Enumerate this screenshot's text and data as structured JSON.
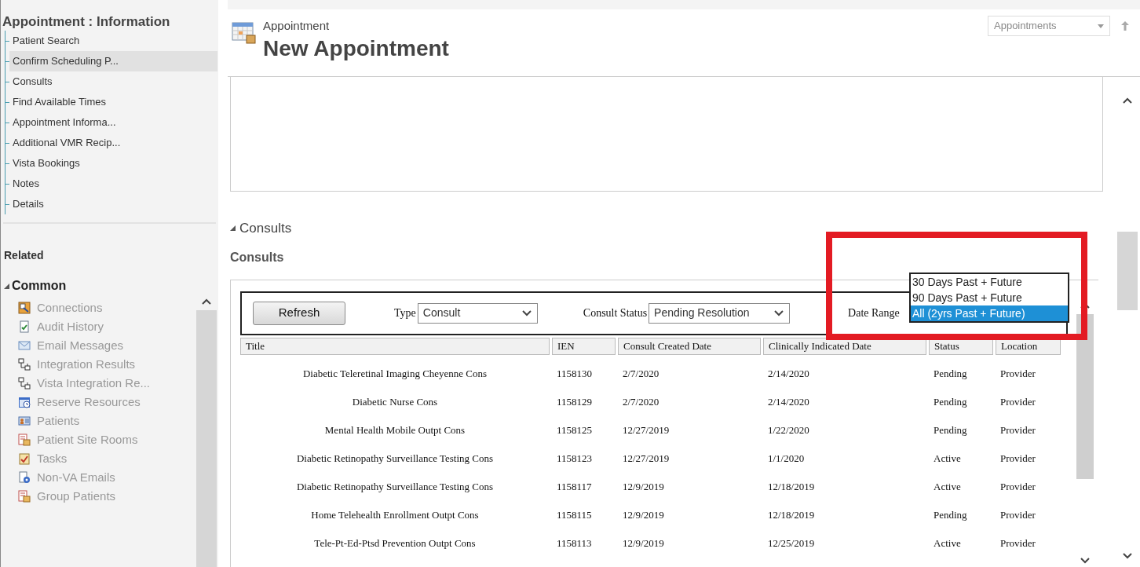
{
  "sidebar": {
    "title": "Appointment : Information",
    "nav_items": [
      {
        "label": "Patient Search",
        "selected": false
      },
      {
        "label": "Confirm Scheduling P...",
        "selected": true
      },
      {
        "label": "Consults",
        "selected": false
      },
      {
        "label": "Find Available Times",
        "selected": false
      },
      {
        "label": "Appointment Informa...",
        "selected": false
      },
      {
        "label": "Additional VMR Recip...",
        "selected": false
      },
      {
        "label": "Vista Bookings",
        "selected": false
      },
      {
        "label": "Notes",
        "selected": false
      },
      {
        "label": "Details",
        "selected": false
      }
    ],
    "related_heading": "Related",
    "group": {
      "label": "Common",
      "expanded": true,
      "items": [
        {
          "label": "Connections",
          "kind": "connections"
        },
        {
          "label": "Audit History",
          "kind": "document"
        },
        {
          "label": "Email Messages",
          "kind": "envelope"
        },
        {
          "label": "Integration Results",
          "kind": "network"
        },
        {
          "label": "Vista Integration Re...",
          "kind": "network"
        },
        {
          "label": "Reserve Resources",
          "kind": "calendar"
        },
        {
          "label": "Patients",
          "kind": "contact"
        },
        {
          "label": "Patient Site Rooms",
          "kind": "box"
        },
        {
          "label": "Tasks",
          "kind": "clipboard"
        },
        {
          "label": "Non-VA Emails",
          "kind": "gear"
        },
        {
          "label": "Group Patients",
          "kind": "box"
        }
      ]
    }
  },
  "header": {
    "entity": "Appointment",
    "title": "New Appointment",
    "form_selector": "Appointments"
  },
  "section_toggle": {
    "label": "Consults",
    "expanded": true
  },
  "consults": {
    "heading": "Consults",
    "refresh": "Refresh",
    "filters": [
      {
        "label": "Type",
        "value": "Consult"
      },
      {
        "label": "Consult Status",
        "value": "Pending Resolution"
      },
      {
        "label": "Date Range"
      }
    ],
    "date_range_options": [
      {
        "label": "30 Days Past + Future",
        "selected": false
      },
      {
        "label": "90 Days Past + Future",
        "selected": false
      },
      {
        "label": "All (2yrs Past + Future)",
        "selected": true
      }
    ],
    "columns": [
      "Title",
      "IEN",
      "Consult Created Date",
      "Clinically Indicated Date",
      "Status",
      "Location"
    ],
    "rows": [
      [
        "Diabetic Teleretinal Imaging Cheyenne Cons",
        "1158130",
        "2/7/2020",
        "2/14/2020",
        "Pending",
        "Provider"
      ],
      [
        "Diabetic Nurse Cons",
        "1158129",
        "2/7/2020",
        "2/14/2020",
        "Pending",
        "Provider"
      ],
      [
        "Mental Health Mobile Outpt Cons",
        "1158125",
        "12/27/2019",
        "1/22/2020",
        "Pending",
        "Provider"
      ],
      [
        "Diabetic Retinopathy Surveillance Testing Cons",
        "1158123",
        "12/27/2019",
        "1/1/2020",
        "Active",
        "Provider"
      ],
      [
        "Diabetic Retinopathy Surveillance Testing Cons",
        "1158117",
        "12/9/2019",
        "12/18/2019",
        "Active",
        "Provider"
      ],
      [
        "Home Telehealth Enrollment Outpt Cons",
        "1158115",
        "12/9/2019",
        "12/18/2019",
        "Pending",
        "Provider"
      ],
      [
        "Tele-Pt-Ed-Ptsd Prevention Outpt Cons",
        "1158113",
        "12/9/2019",
        "12/25/2019",
        "Active",
        "Provider"
      ]
    ]
  }
}
